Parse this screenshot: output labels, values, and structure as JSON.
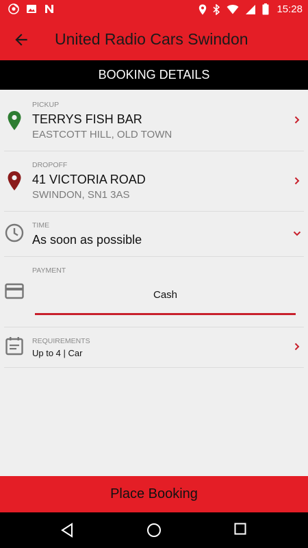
{
  "status_bar": {
    "time": "15:28",
    "left_icons": [
      "chrome-icon",
      "image-icon",
      "app-n-icon"
    ],
    "right_icons": [
      "location-icon",
      "bluetooth-icon",
      "wifi-icon",
      "signal-icon",
      "battery-icon"
    ]
  },
  "app_bar": {
    "title": "United Radio Cars Swindon",
    "background": "#e41e26"
  },
  "section_header": "BOOKING DETAILS",
  "pickup": {
    "label": "PICKUP",
    "name": "TERRYS FISH BAR",
    "address": "EASTCOTT HILL, OLD TOWN",
    "pin_color": "#2e7d32"
  },
  "dropoff": {
    "label": "DROPOFF",
    "name": "41 VICTORIA ROAD",
    "address": "SWINDON, SN1 3AS",
    "pin_color": "#8b1a1a"
  },
  "time": {
    "label": "TIME",
    "value": "As soon as possible"
  },
  "payment": {
    "label": "PAYMENT",
    "selected": "Cash"
  },
  "requirements": {
    "label": "REQUIREMENTS",
    "value": "Up to 4 | Car"
  },
  "place_booking_label": "Place Booking",
  "accent_color": "#c8202c"
}
